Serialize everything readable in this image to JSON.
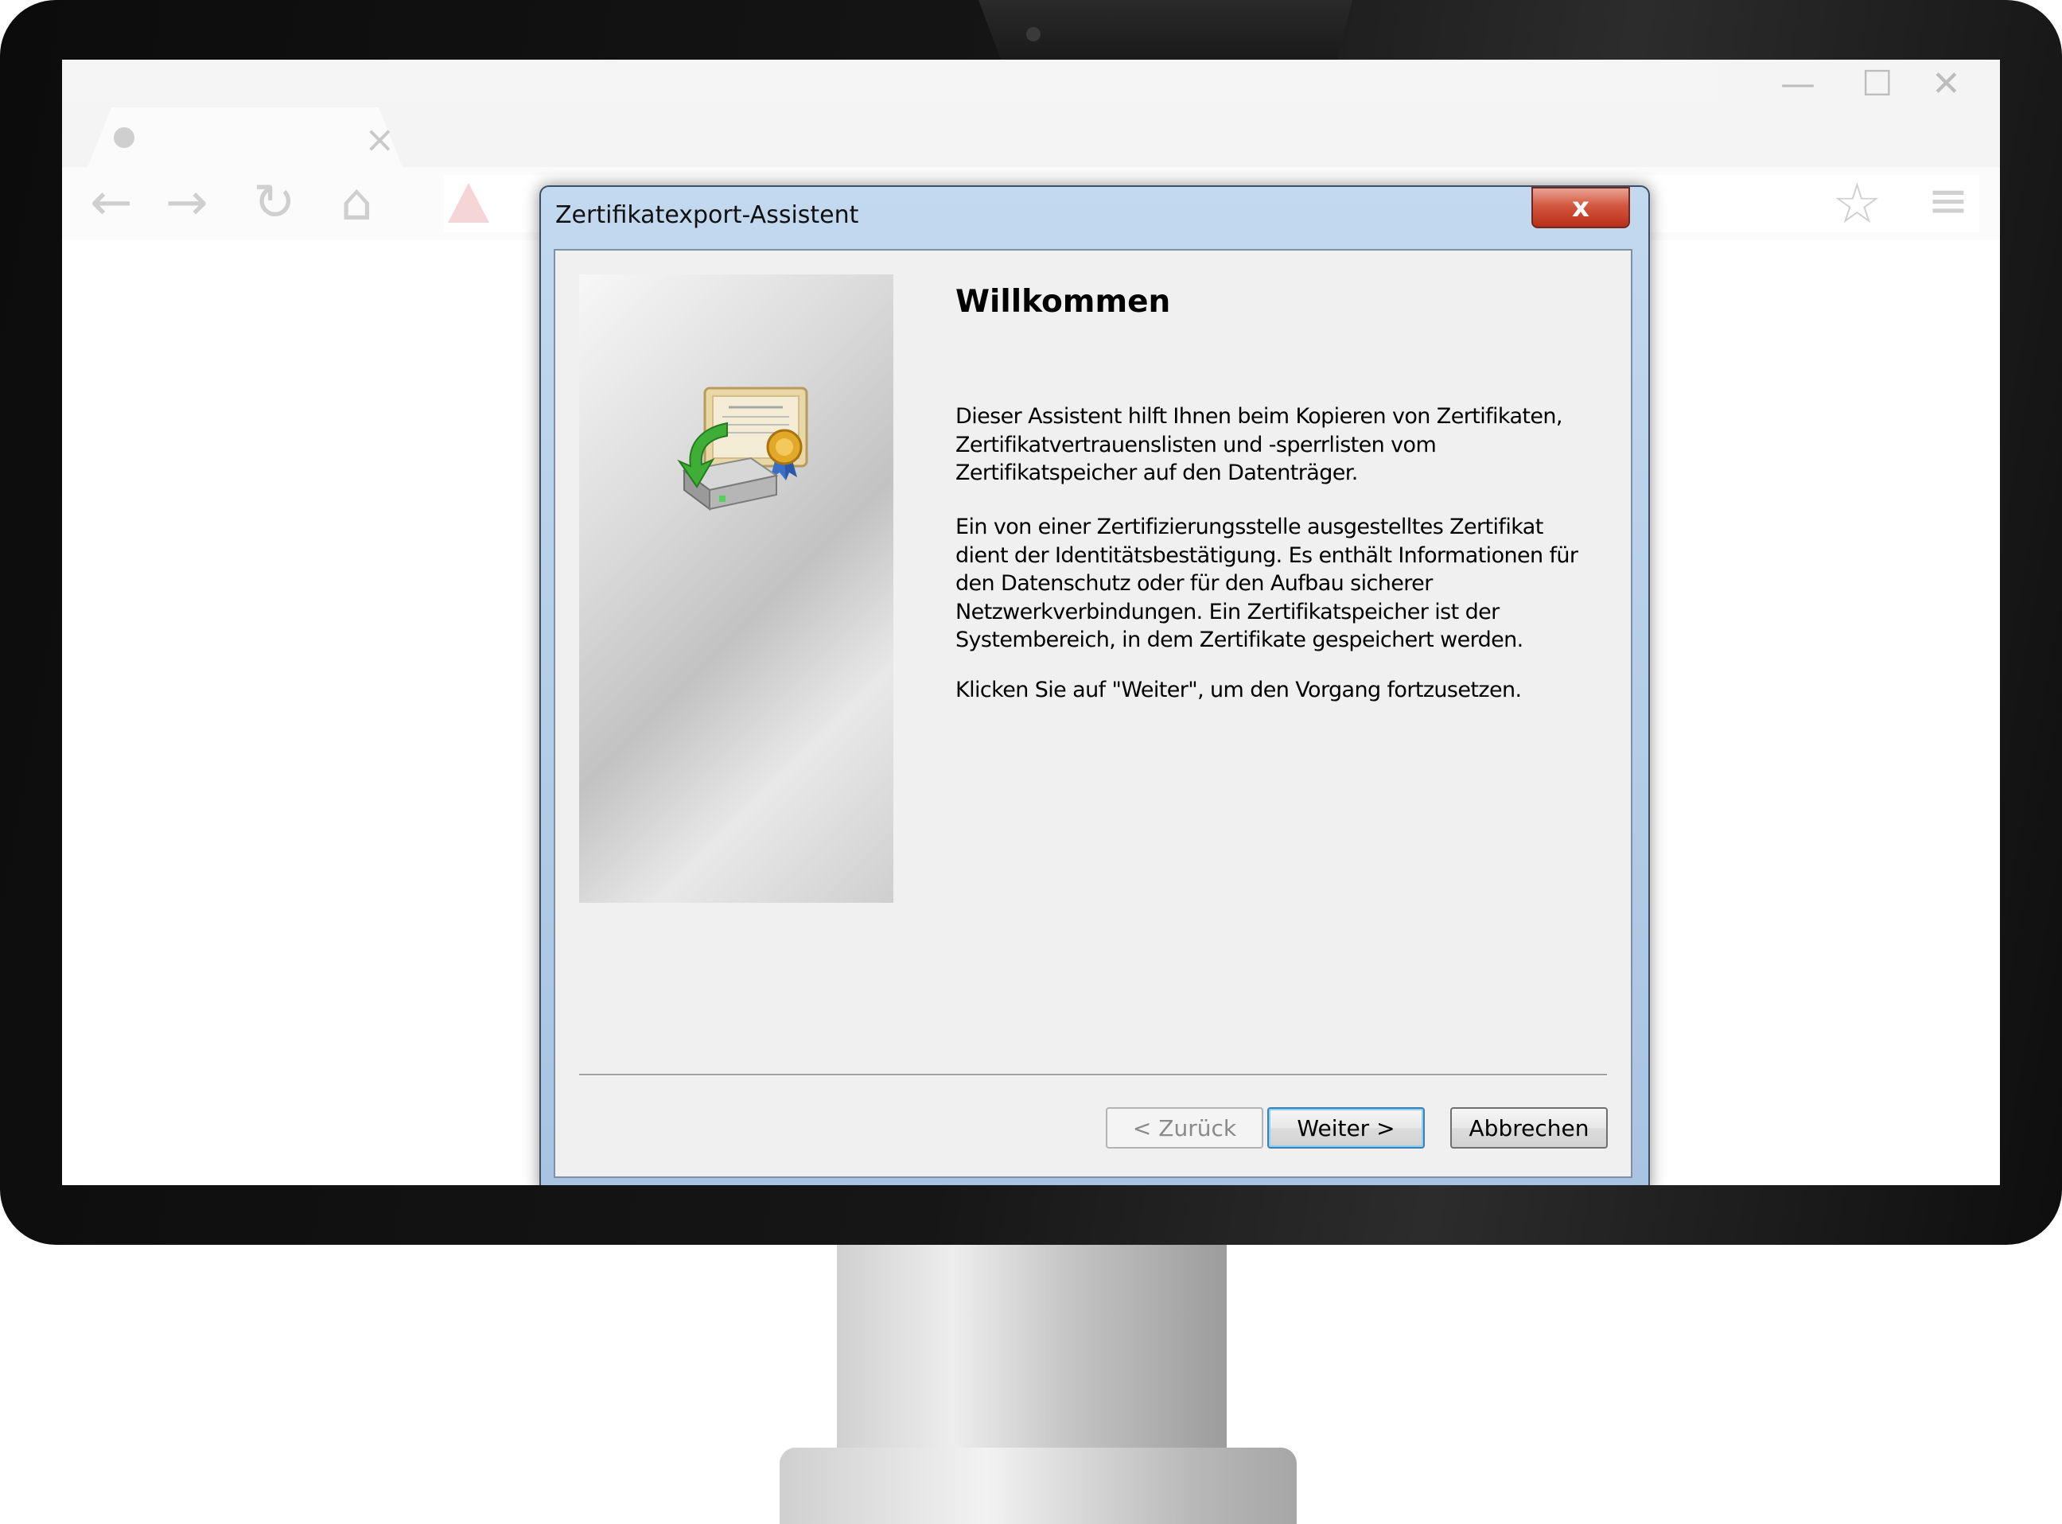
{
  "browser": {
    "tab_close_glyph": "×",
    "window_controls": {
      "minimize": "—",
      "maximize": "☐",
      "close": "✕"
    },
    "toolbar": {
      "back": "←",
      "forward": "→",
      "reload": "↻",
      "home": "⌂",
      "bookmark": "☆",
      "menu": "≡"
    }
  },
  "dialog": {
    "title": "Zertifikatexport-Assistent",
    "close_glyph": "x",
    "heading": "Willkommen",
    "paragraph_1": "Dieser Assistent hilft Ihnen beim Kopieren von Zertifikaten, Zertifikatvertrauenslisten und -sperrlisten vom Zertifikatspeicher auf den Datenträger.",
    "paragraph_2": "Ein von einer Zertifizierungsstelle ausgestelltes Zertifikat dient der Identitätsbestätigung. Es enthält Informationen für den Datenschutz oder für den Aufbau sicherer Netzwerkverbindungen. Ein Zertifikatspeicher ist der Systembereich, in dem Zertifikate gespeichert werden.",
    "paragraph_3": "Klicken Sie auf \"Weiter\", um den Vorgang fortzusetzen.",
    "buttons": {
      "back": "< Zurück",
      "next": "Weiter >",
      "cancel": "Abbrechen"
    },
    "back_enabled": false,
    "wizard_icon": "certificate-export-icon"
  },
  "colors": {
    "dialog_frame": "#b9d1ea",
    "close_button": "#c8452c",
    "dialog_body": "#f0f0f0",
    "default_button_border": "#3c7fb1"
  }
}
